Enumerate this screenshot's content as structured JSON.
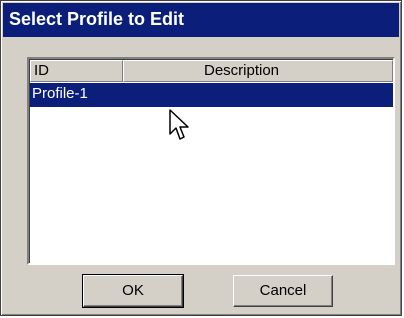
{
  "window": {
    "title": "Select Profile to Edit"
  },
  "list": {
    "columns": [
      "ID",
      "Description"
    ],
    "rows": [
      {
        "id": "Profile-1",
        "description": "",
        "selected": true
      }
    ]
  },
  "buttons": {
    "ok_label": "OK",
    "cancel_label": "Cancel"
  },
  "colors": {
    "titlebar": "#0a1e7a",
    "selection": "#0a1e7a",
    "face": "#d4d0c8"
  },
  "icons": {
    "cursor": "arrow-cursor-icon"
  }
}
